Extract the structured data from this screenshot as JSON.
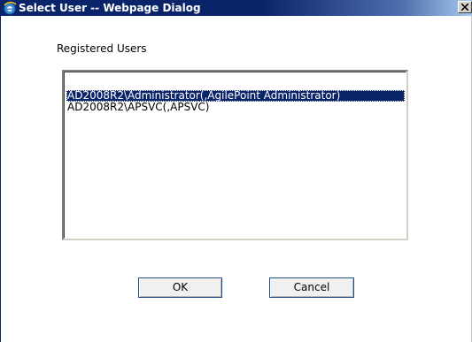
{
  "window": {
    "title": "Select User -- Webpage Dialog"
  },
  "dialog": {
    "label": "Registered Users",
    "users": [
      "AD2008R2\\Administrator(,AgilePoint Administrator)",
      "AD2008R2\\APSVC(,APSVC)"
    ],
    "selected_index": 0,
    "ok_label": "OK",
    "cancel_label": "Cancel"
  },
  "icons": {
    "title_icon": "ie-icon",
    "close_icon": "close-icon"
  },
  "colors": {
    "titlebar": "#0a246a",
    "selection": "#0a246a"
  }
}
